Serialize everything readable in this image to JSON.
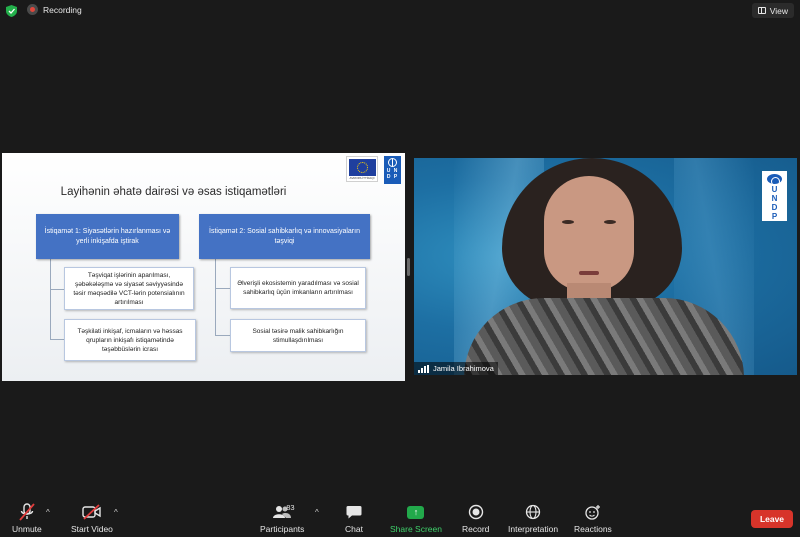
{
  "topbar": {
    "recording_label": "Recording",
    "view_label": "View"
  },
  "slide": {
    "title": "Layihənin əhatə dairəsi və əsas istiqamətləri",
    "eu_caption": "AVROPA İTTİFAQI",
    "undp_text": "U N D P",
    "direction1": "İstiqamət 1: Siyasətlərin hazırlanması və yerli inkişafda iştirak",
    "direction2": "İstiqamət 2: Sosial sahibkarlıq və innovasiyaların təşviqi",
    "items1": [
      "Təşviqat işlərinin aparılması, şəbəkələşmə və siyasət səviyyəsində təsir məqsədilə VCT-lərin potensialının artırılması",
      "Təşkilati inkişaf, icmaların və həssas qrupların inkişafı istiqamətində təşəbbüslərin icrası"
    ],
    "items2": [
      "Əlverişli ekosistemin yaradılması və sosial sahibkarlıq üçün imkanların artırılması",
      "Sosial təsirə malik sahibkarlığın stimullaşdırılması"
    ]
  },
  "speaker": {
    "name": "Jamila Ibrahimova",
    "logo_text": "U N D P"
  },
  "toolbar": {
    "unmute": "Unmute",
    "start_video": "Start Video",
    "participants": "Participants",
    "participants_count": "83",
    "chat": "Chat",
    "share_screen": "Share Screen",
    "record": "Record",
    "interpretation": "Interpretation",
    "reactions": "Reactions",
    "leave": "Leave"
  },
  "colors": {
    "background": "#1a1a1a",
    "slide_box": "#4472c4",
    "share_green": "#22a94b",
    "leave_red": "#d7342a"
  }
}
